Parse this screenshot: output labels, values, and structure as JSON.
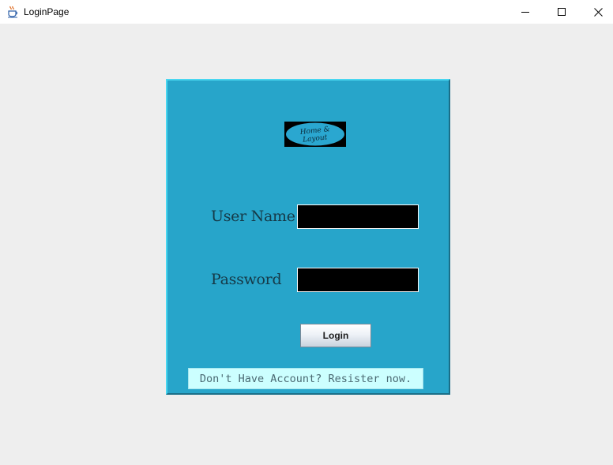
{
  "window": {
    "title": "LoginPage",
    "icon": "java-cup-icon",
    "controls": [
      "minimize",
      "maximize",
      "close"
    ]
  },
  "logo": {
    "text": "Home & Layout"
  },
  "form": {
    "username_label": "User Name",
    "username_value": "",
    "password_label": "Password",
    "password_value": "",
    "login_label": "Login",
    "register_text": "Don't Have Account? Resister now."
  },
  "colors": {
    "window_background": "#eeeeee",
    "panel_background": "#27a5ca",
    "field_background": "#000000",
    "register_background": "#ccffff"
  }
}
